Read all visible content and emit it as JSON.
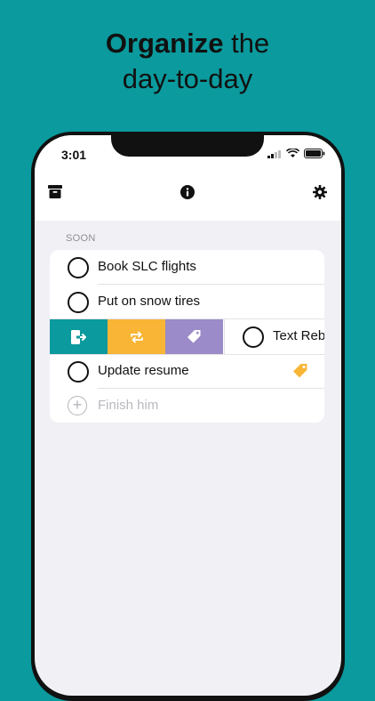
{
  "headline": {
    "bold": "Organize",
    "rest_line1": " the",
    "line2": "day-to-day"
  },
  "status_bar": {
    "time": "3:01"
  },
  "section": {
    "title": "SOON"
  },
  "tasks": [
    {
      "label": "Book SLC flights"
    },
    {
      "label": "Put on snow tires"
    },
    {
      "label": "Text Rebe"
    },
    {
      "label": "Update resume"
    }
  ],
  "add_task": {
    "placeholder": "Finish him"
  },
  "icons": {
    "archive": "archive-box-icon",
    "info": "info-icon",
    "settings": "gear-icon",
    "swipe_archive": "move-out-icon",
    "swipe_repeat": "repeat-icon",
    "swipe_tag": "tag-icon",
    "task_tag": "tag-icon"
  },
  "colors": {
    "background": "#0b9a9d",
    "archive_action": "#0b9a9d",
    "repeat_action": "#f8b536",
    "tag_action": "#9b8bc8",
    "tag_badge": "#f8b536"
  }
}
